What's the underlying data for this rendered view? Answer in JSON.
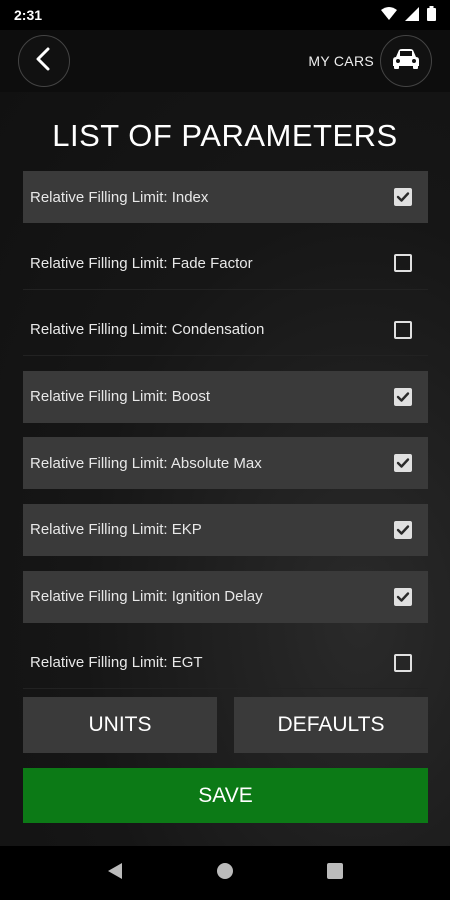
{
  "status": {
    "time": "2:31"
  },
  "header": {
    "my_cars_label": "MY CARS"
  },
  "page_title": "LIST OF PARAMETERS",
  "parameters": [
    {
      "label": "Relative Filling Limit: Index",
      "checked": true
    },
    {
      "label": "Relative Filling Limit: Fade Factor",
      "checked": false
    },
    {
      "label": "Relative Filling Limit: Condensation",
      "checked": false
    },
    {
      "label": "Relative Filling Limit: Boost",
      "checked": true
    },
    {
      "label": "Relative Filling Limit: Absolute Max",
      "checked": true
    },
    {
      "label": "Relative Filling Limit: EKP",
      "checked": true
    },
    {
      "label": "Relative Filling Limit: Ignition Delay",
      "checked": true
    },
    {
      "label": "Relative Filling Limit: EGT",
      "checked": false
    }
  ],
  "buttons": {
    "units": "UNITS",
    "defaults": "DEFAULTS",
    "save": "SAVE"
  },
  "colors": {
    "save_green": "#0c7a16",
    "row_checked_bg": "#3a3a3a",
    "button_gray": "#3a3a3a"
  },
  "icons": [
    "back-arrow-icon",
    "car-icon",
    "wifi-icon",
    "cell-signal-icon",
    "battery-icon",
    "nav-back-icon",
    "nav-home-icon",
    "nav-recents-icon"
  ]
}
